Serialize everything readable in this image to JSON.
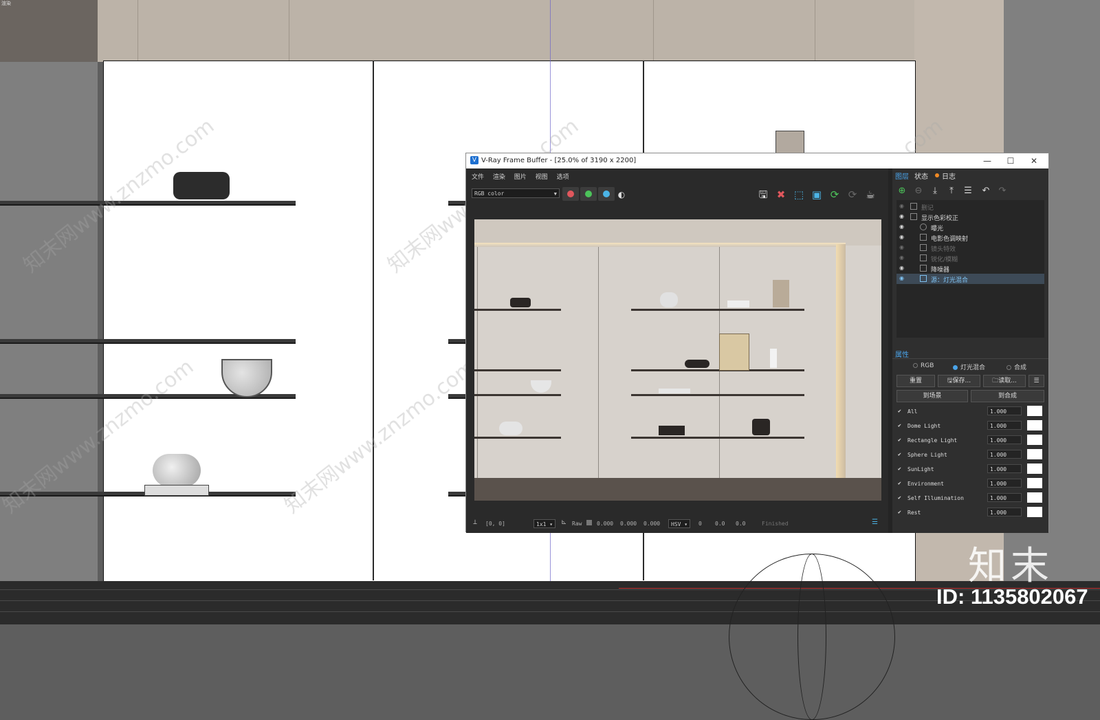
{
  "viewport": {
    "corner_label": "渲染",
    "watermark_text": "知末网www.znzmo.com",
    "brand_text": "知末",
    "id_text": "ID: 1135802067"
  },
  "vfb": {
    "title": "V-Ray Frame Buffer - [25.0% of 3190 x 2200]",
    "app_icon": "V",
    "window_controls": {
      "minimize": "—",
      "maximize": "☐",
      "close": "✕"
    },
    "menu": [
      "文件",
      "渲染",
      "图片",
      "视图",
      "选项"
    ],
    "channel_select": "RGB color",
    "channel_colors": [
      "#e0575d",
      "#4cc35a",
      "#4bb4e6"
    ],
    "status": {
      "coords": "[0, 0]",
      "zoom": "1x1",
      "raw_label": "Raw",
      "raw_values": [
        "0.000",
        "0.000",
        "0.000"
      ],
      "color_mode": "HSV",
      "hsv_values": [
        "0",
        "0.0",
        "0.0"
      ],
      "state": "Finished"
    },
    "right_panel": {
      "tabs": [
        "图层",
        "状态",
        "日志"
      ],
      "layers": [
        {
          "label": "删记",
          "visible": false,
          "indent": 1
        },
        {
          "label": "显示色彩校正",
          "visible": true,
          "indent": 1
        },
        {
          "label": "曝光",
          "visible": true,
          "indent": 2
        },
        {
          "label": "电影色调映射",
          "visible": true,
          "indent": 2
        },
        {
          "label": "镜头特效",
          "visible": false,
          "indent": 2
        },
        {
          "label": "锐化/模糊",
          "visible": false,
          "indent": 2
        },
        {
          "label": "降噪器",
          "visible": true,
          "indent": 2
        },
        {
          "label": "源：灯光混合",
          "visible": true,
          "indent": 2,
          "selected": true
        }
      ],
      "properties_title": "属性",
      "source_options": [
        "RGB",
        "灯光混合",
        "合成"
      ],
      "source_selected": "灯光混合",
      "buttons": {
        "reset": "重置",
        "save": "保存...",
        "load": "读取...",
        "to_scene": "到场景",
        "to_composite": "到合成"
      },
      "light_mix": [
        {
          "name": "All",
          "value": "1.000"
        },
        {
          "name": "Dome Light",
          "value": "1.000"
        },
        {
          "name": "Rectangle Light",
          "value": "1.000"
        },
        {
          "name": "Sphere Light",
          "value": "1.000"
        },
        {
          "name": "SunLight",
          "value": "1.000"
        },
        {
          "name": "Environment",
          "value": "1.000"
        },
        {
          "name": "Self Illumination",
          "value": "1.000"
        },
        {
          "name": "Rest",
          "value": "1.000"
        }
      ]
    }
  }
}
